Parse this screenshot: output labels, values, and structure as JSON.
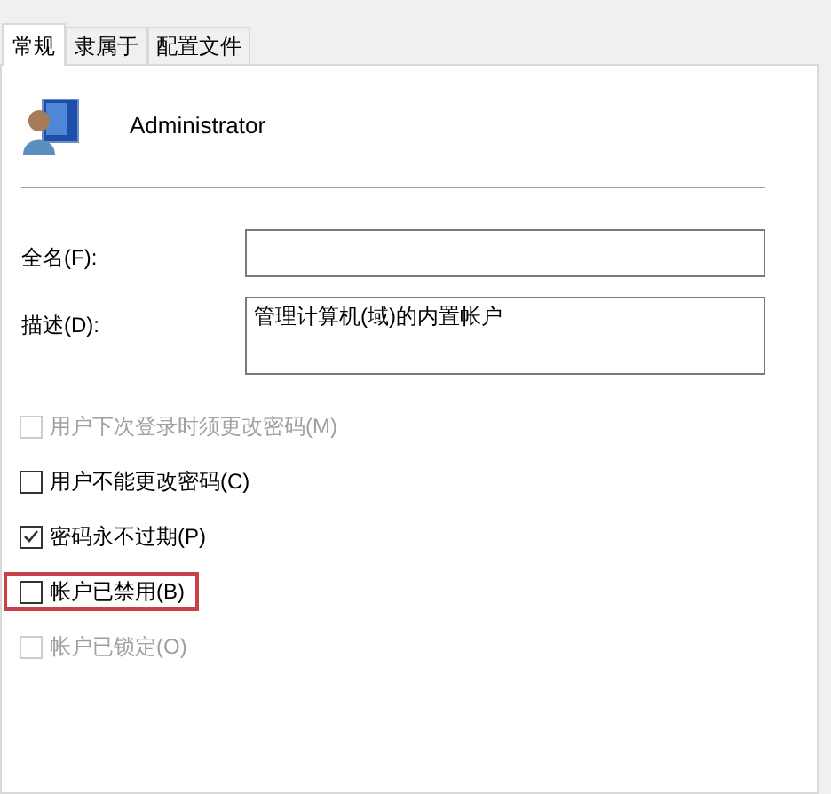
{
  "tabs": [
    {
      "label": "常规",
      "selected": true
    },
    {
      "label": "隶属于",
      "selected": false
    },
    {
      "label": "配置文件",
      "selected": false
    }
  ],
  "user": {
    "name": "Administrator"
  },
  "fields": [
    {
      "label": "全名(F):",
      "kind": "line"
    },
    {
      "label": "描述(D):",
      "value": "管理计算机(域)的内置帐户",
      "kind": "box"
    }
  ],
  "options": [
    {
      "label": "用户下次登录时须更改密码(M)",
      "checked": false,
      "disabled": true,
      "highlighted": false
    },
    {
      "label": "用户不能更改密码(C)",
      "checked": false,
      "disabled": false,
      "highlighted": false
    },
    {
      "label": "密码永不过期(P)",
      "checked": true,
      "disabled": false,
      "highlighted": false
    },
    {
      "label": "帐户已禁用(B)",
      "checked": false,
      "disabled": false,
      "highlighted": true
    },
    {
      "label": "帐户已锁定(O)",
      "checked": false,
      "disabled": true,
      "highlighted": false
    }
  ]
}
